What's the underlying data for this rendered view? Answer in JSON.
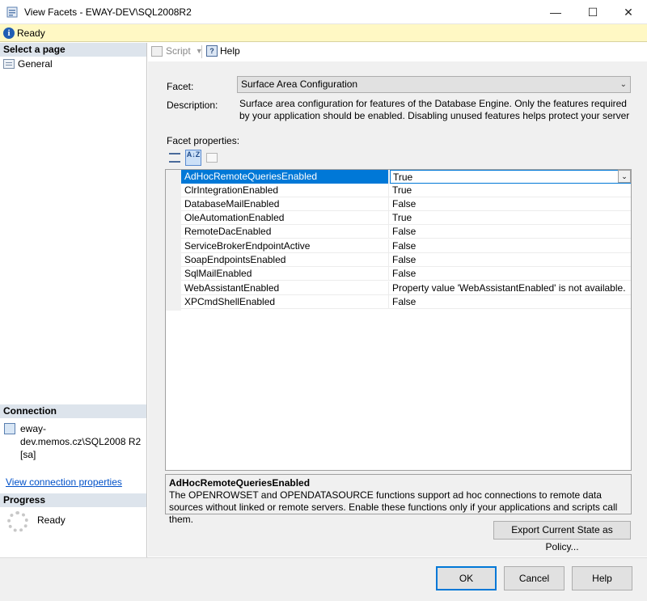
{
  "window": {
    "title": "View Facets - EWAY-DEV\\SQL2008R2",
    "min_glyph": "—",
    "max_glyph": "☐",
    "close_glyph": "✕"
  },
  "status": {
    "text": "Ready",
    "icon": "info-icon",
    "info_glyph": "i"
  },
  "left": {
    "select_page_header": "Select a page",
    "pages": [
      {
        "label": "General",
        "icon": "page-icon"
      }
    ],
    "connection_header": "Connection",
    "connection_text": "eway-dev.memos.cz\\SQL2008 R2 [sa]",
    "connection_link": "View connection properties",
    "progress_header": "Progress",
    "progress_text": "Ready"
  },
  "toolbar": {
    "script_label": "Script",
    "script_chevron": "▼",
    "help_label": "Help",
    "help_glyph": "?"
  },
  "form": {
    "facet_label": "Facet:",
    "facet_value": "Surface Area Configuration",
    "description_label": "Description:",
    "description_text": "Surface area configuration for features of the Database Engine. Only the features required by your application should be enabled. Disabling unused features helps protect your server by reducing the",
    "facet_properties_label": "Facet properties:",
    "alpha_sort_glyph": "A↓Z"
  },
  "properties": [
    {
      "name": "AdHocRemoteQueriesEnabled",
      "value": "True",
      "selected": true
    },
    {
      "name": "ClrIntegrationEnabled",
      "value": "True"
    },
    {
      "name": "DatabaseMailEnabled",
      "value": "False"
    },
    {
      "name": "OleAutomationEnabled",
      "value": "True"
    },
    {
      "name": "RemoteDacEnabled",
      "value": "False"
    },
    {
      "name": "ServiceBrokerEndpointActive",
      "value": "False"
    },
    {
      "name": "SoapEndpointsEnabled",
      "value": "False"
    },
    {
      "name": "SqlMailEnabled",
      "value": "False"
    },
    {
      "name": "WebAssistantEnabled",
      "value": "Property value 'WebAssistantEnabled' is not available."
    },
    {
      "name": "XPCmdShellEnabled",
      "value": "False"
    }
  ],
  "help_panel": {
    "title": "AdHocRemoteQueriesEnabled",
    "body": "The OPENROWSET and OPENDATASOURCE functions support ad hoc connections to remote data sources without linked or remote servers. Enable these functions only if your applications and scripts call them."
  },
  "buttons": {
    "export": "Export Current State as Policy...",
    "ok": "OK",
    "cancel": "Cancel",
    "help": "Help"
  },
  "colors": {
    "accent": "#0078d7",
    "status_bar": "#fff8c4",
    "section_header": "#dde4ec",
    "link": "#0050c8"
  }
}
